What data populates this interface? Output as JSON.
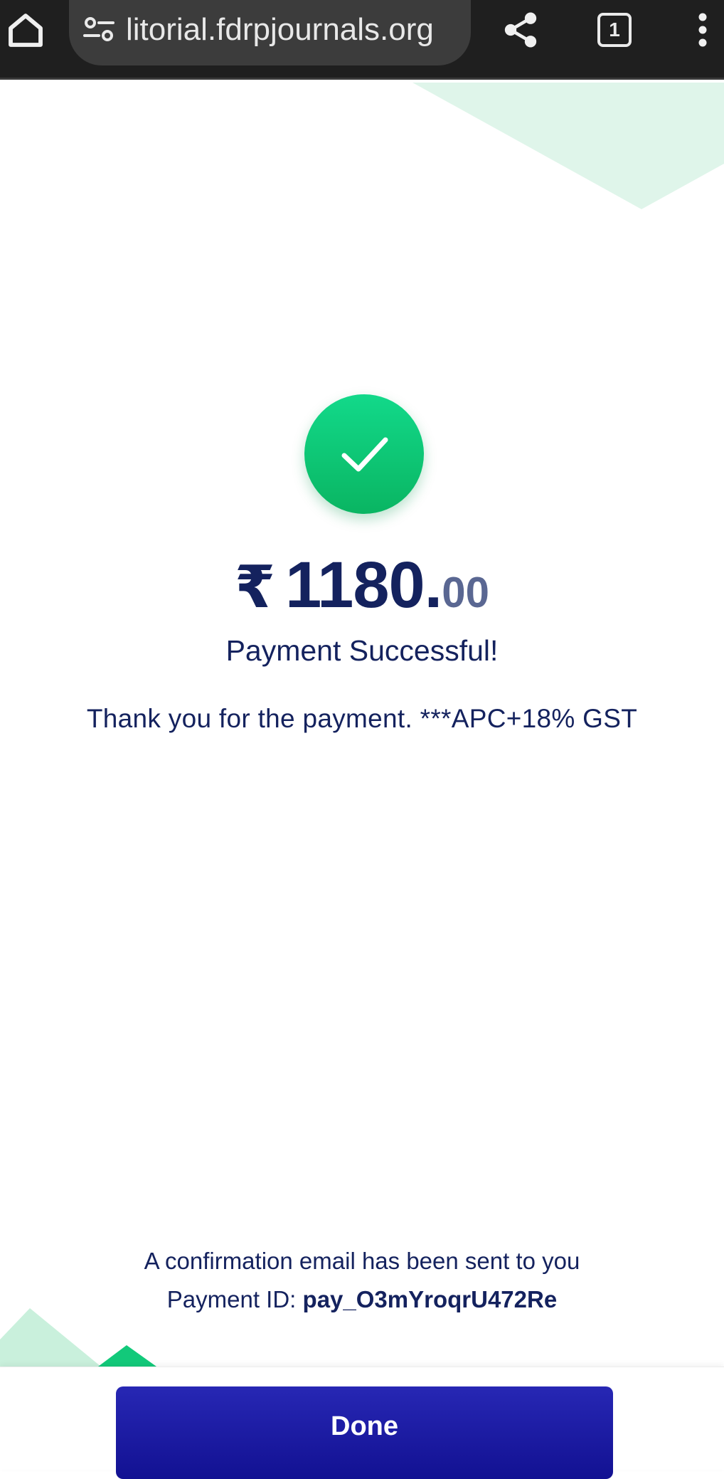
{
  "browser": {
    "url": "litorial.fdrpjournals.org",
    "tab_count": "1",
    "icons": [
      "home-icon",
      "site-settings-icon",
      "share-icon",
      "tabs-icon",
      "more-vert-icon"
    ]
  },
  "payment": {
    "currency_symbol": "₹",
    "amount_whole": "1180.",
    "amount_fraction": "00",
    "status": "Payment Successful!",
    "description": "Thank you for the payment. ***APC+18% GST",
    "confirmation": "A confirmation email has been sent to you",
    "payment_id_label": "Payment ID:",
    "payment_id": "pay_O3mYroqrU472Re",
    "status_icon": "check-icon"
  },
  "footer": {
    "done_label": "Done"
  },
  "colors": {
    "success": "#0fc676",
    "primary": "#1a1aa3",
    "text": "#14225e",
    "deco_light": "#dff5ea"
  }
}
